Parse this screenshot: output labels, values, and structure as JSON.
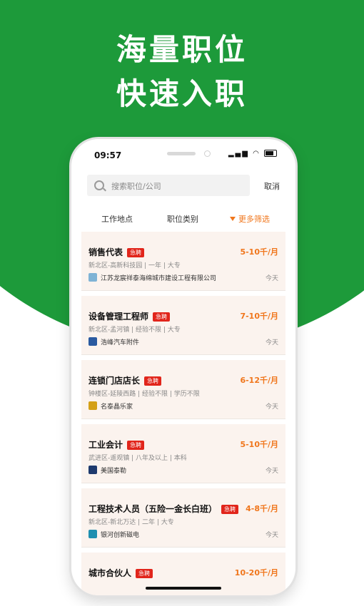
{
  "headline": {
    "line1": "海量职位",
    "line2": "快速入职"
  },
  "status": {
    "time": "09:57",
    "icons": "▂▄▆ ◠"
  },
  "search": {
    "placeholder": "搜索职位/公司",
    "cancel": "取消"
  },
  "filters": {
    "location": "工作地点",
    "category": "职位类别",
    "more": "更多筛选"
  },
  "jobs": [
    {
      "title": "销售代表",
      "badge": "急聘",
      "salary": "5-10千/月",
      "meta": "新北区-高新科技园 | 一年 | 大专",
      "company": "江苏龙宸祥泰海绵城市建设工程有限公司",
      "date": "今天",
      "logo_color": "#7fb3d5"
    },
    {
      "title": "设备管理工程师",
      "badge": "急聘",
      "salary": "7-10千/月",
      "meta": "新北区-孟河镇 | 经验不限 | 大专",
      "company": "浩峰汽车附件",
      "date": "今天",
      "logo_color": "#2a5aa0"
    },
    {
      "title": "连锁门店店长",
      "badge": "急聘",
      "salary": "6-12千/月",
      "meta": "钟楼区-延陵西路 | 经验不限 | 学历不限",
      "company": "名泰晶乐家",
      "date": "今天",
      "logo_color": "#d4a017"
    },
    {
      "title": "工业会计",
      "badge": "急聘",
      "salary": "5-10千/月",
      "meta": "武进区-遥观镇 | 八年及以上 | 本科",
      "company": "美国泰勒",
      "date": "今天",
      "logo_color": "#1e3a6e"
    },
    {
      "title": "工程技术人员（五险一金长白班）",
      "badge": "急聘",
      "salary": "4-8千/月",
      "meta": "新北区-新北万达 | 二年 | 大专",
      "company": "银河创新磁电",
      "date": "今天",
      "logo_color": "#1f8fb0"
    },
    {
      "title": "城市合伙人",
      "badge": "急聘",
      "salary": "10-20千/月",
      "meta": "",
      "company": "",
      "date": "",
      "logo_color": "#cccccc"
    }
  ]
}
